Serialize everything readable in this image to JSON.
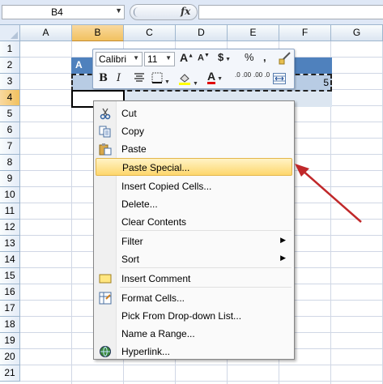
{
  "formula_bar": {
    "name_box": "B4",
    "fx_label": "fx",
    "formula": ""
  },
  "columns": [
    "A",
    "B",
    "C",
    "D",
    "E",
    "F",
    "G"
  ],
  "selected_column": "B",
  "rows": [
    "1",
    "2",
    "3",
    "4",
    "5",
    "6",
    "7",
    "8",
    "9",
    "10",
    "11",
    "12",
    "13",
    "14",
    "15",
    "16",
    "17",
    "18",
    "19",
    "20",
    "21"
  ],
  "selected_row": "4",
  "cells": {
    "a2": "A",
    "f3": "5"
  },
  "mini_toolbar": {
    "font": "Calibri",
    "size": "11",
    "grow_font": "A",
    "shrink_font": "A",
    "currency": "$",
    "percent": "%",
    "comma": ",",
    "bold": "B",
    "italic": "I",
    "font_color": "A",
    "increase_decimal": ".0 .00",
    "decrease_decimal": ".00 .0"
  },
  "context_menu": {
    "items": [
      {
        "label": "Cut",
        "icon": "scissors-icon"
      },
      {
        "label": "Copy",
        "icon": "copy-icon"
      },
      {
        "label": "Paste",
        "icon": "paste-icon"
      },
      {
        "label": "Paste Special...",
        "icon": "",
        "highlighted": true
      },
      {
        "label": "Insert Copied Cells...",
        "icon": ""
      },
      {
        "label": "Delete...",
        "icon": ""
      },
      {
        "label": "Clear Contents",
        "icon": ""
      },
      {
        "label": "Filter",
        "icon": "",
        "submenu": true
      },
      {
        "label": "Sort",
        "icon": "",
        "submenu": true
      },
      {
        "label": "Insert Comment",
        "icon": "comment-icon"
      },
      {
        "label": "Format Cells...",
        "icon": "format-cells-icon"
      },
      {
        "label": "Pick From Drop-down List...",
        "icon": ""
      },
      {
        "label": "Name a Range...",
        "icon": ""
      },
      {
        "label": "Hyperlink...",
        "icon": "hyperlink-icon"
      }
    ]
  },
  "colors": {
    "header_band": "#4f81bd",
    "row3_fill": "#b8cce4",
    "row4_fill": "#dce6f1",
    "highlight": "#fed76d",
    "arrow": "#c0282a"
  }
}
